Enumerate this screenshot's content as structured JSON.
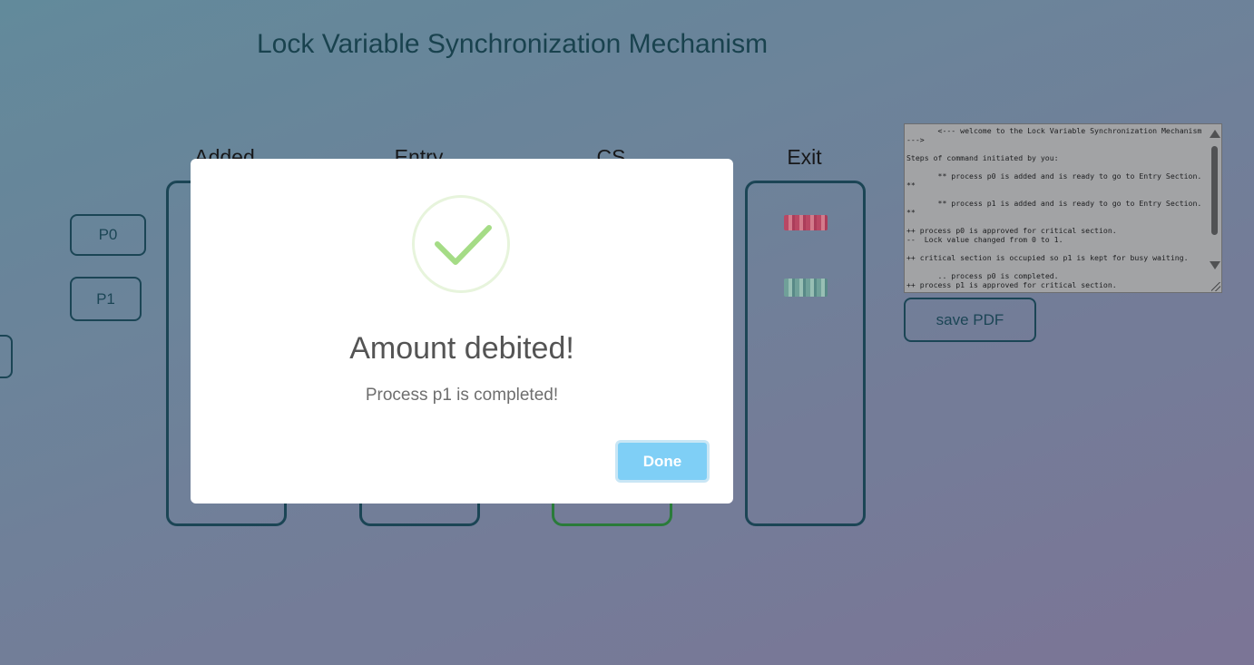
{
  "page": {
    "title": "Lock Variable Synchronization Mechanism"
  },
  "columns": [
    {
      "label": "Added"
    },
    {
      "label": "Entry"
    },
    {
      "label": "CS"
    },
    {
      "label": "Exit"
    }
  ],
  "processes": [
    {
      "label": "P0"
    },
    {
      "label": "P1"
    }
  ],
  "log": {
    "lines": "       <--- welcome to the Lock Variable Synchronization Mechanism --->\n\nSteps of command initiated by you:\n\n       ** process p0 is added and is ready to go to Entry Section. **\n\n       ** process p1 is added and is ready to go to Entry Section. **\n\n++ process p0 is approved for critical section.\n--  Lock value changed from 0 to 1.\n\n++ critical section is occupied so p1 is kept for busy waiting.\n\n       .. process p0 is completed.\n++ process p1 is approved for critical section."
  },
  "toolbar": {
    "save_label": "save PDF"
  },
  "exit_items": [
    {
      "icon": "banknote-red-icon"
    },
    {
      "icon": "banknote-green-icon"
    }
  ],
  "modal": {
    "title": "Amount debited!",
    "text": "Process p1 is completed!",
    "button_label": "Done",
    "icon": "success-check-icon"
  },
  "colors": {
    "accent": "#0e3d4d",
    "cs_border": "#1f7a2e",
    "done_button": "#7fcff6",
    "check": "#a5dc86"
  }
}
